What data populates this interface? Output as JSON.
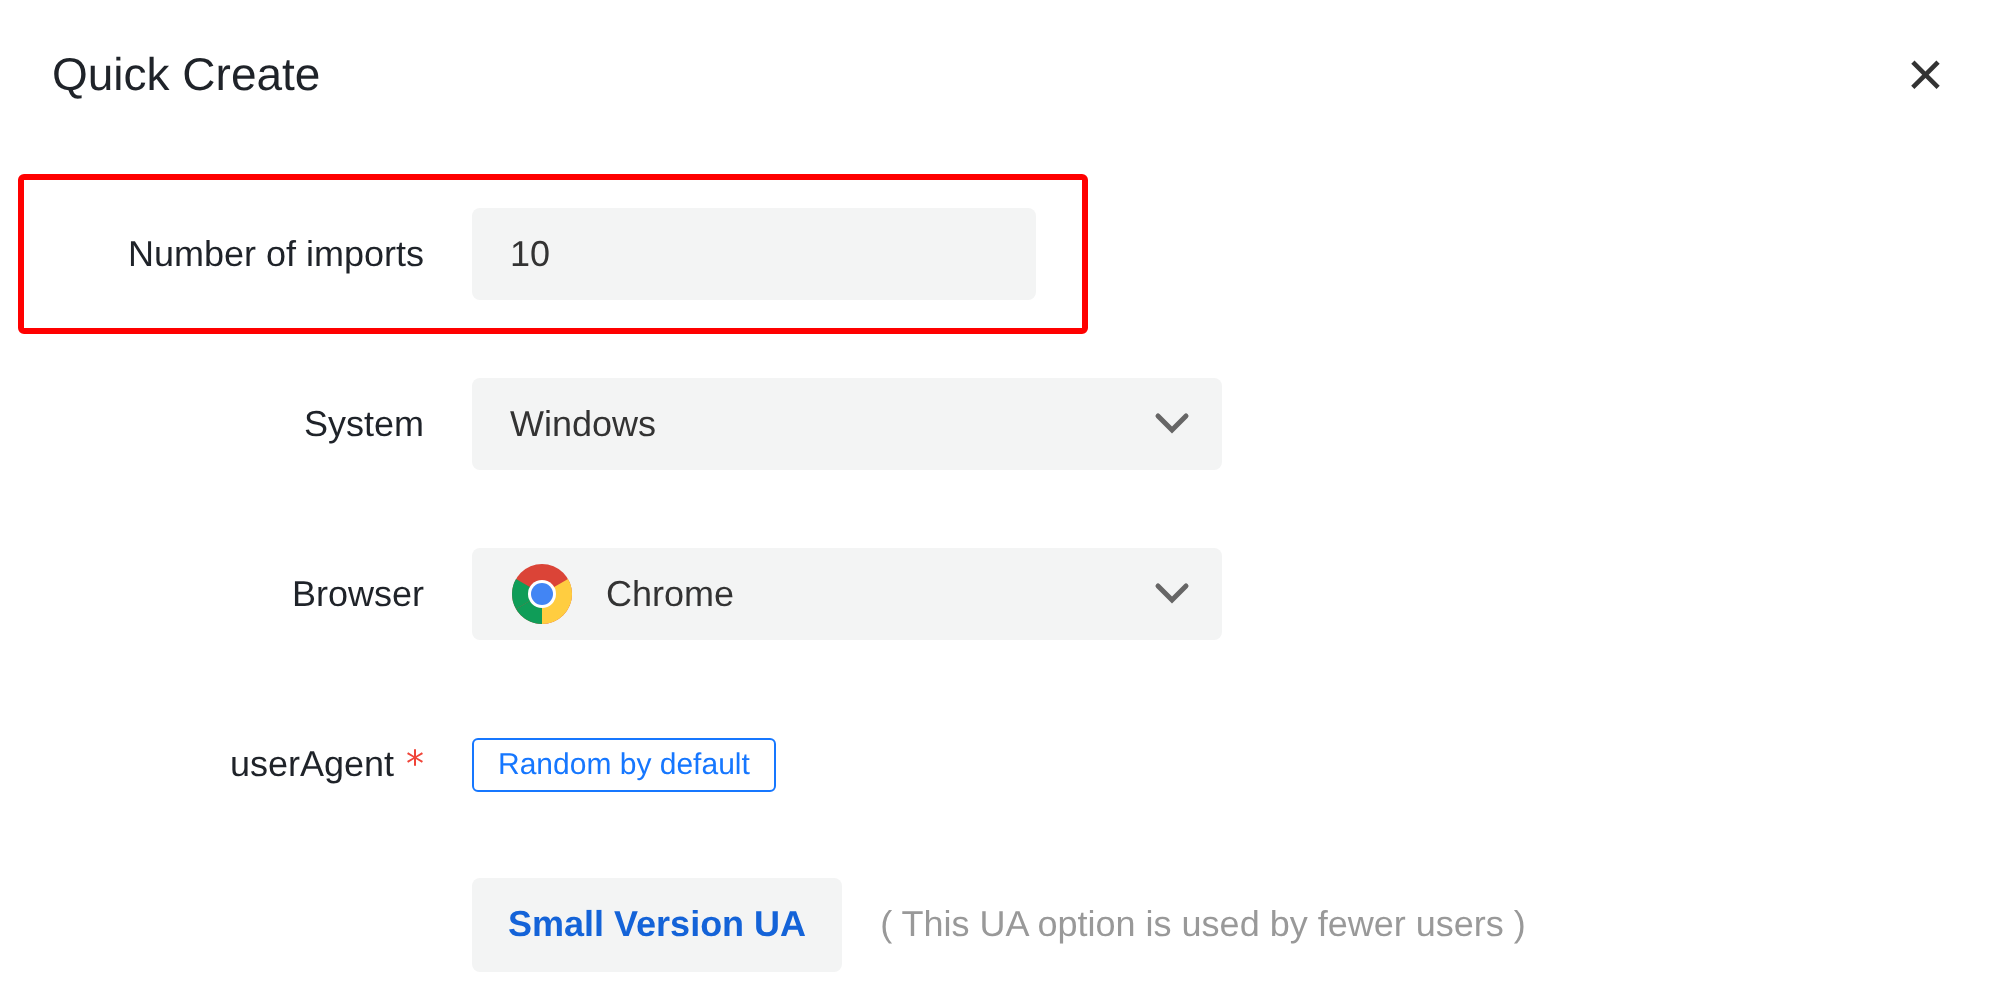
{
  "dialog": {
    "title": "Quick Create",
    "close": "×"
  },
  "fields": [
    {
      "kind": "text",
      "label": "Number of imports",
      "value": "10",
      "required": false,
      "highlighted": true
    },
    {
      "kind": "select",
      "label": "System",
      "value": "Windows",
      "required": false,
      "highlighted": false
    },
    {
      "kind": "browser",
      "label": "Browser",
      "value": "Chrome",
      "required": false,
      "highlighted": false
    },
    {
      "kind": "tag",
      "label": "userAgent",
      "value": "Random by default",
      "required": true,
      "required_mark": "*",
      "highlighted": false
    }
  ],
  "extra": {
    "button": "Small Version UA",
    "hint": "( This UA option is used by fewer users )"
  }
}
